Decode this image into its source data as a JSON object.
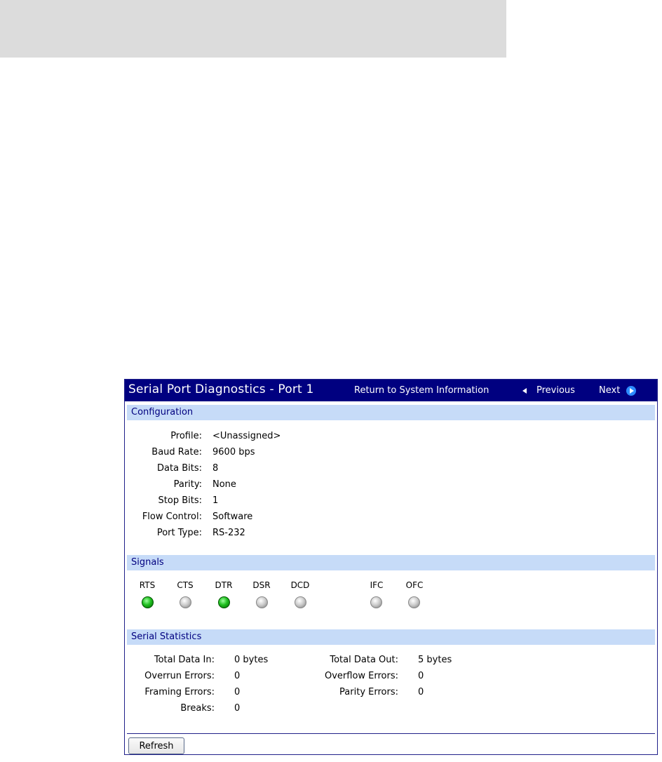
{
  "panel": {
    "title": "Serial Port Diagnostics - Port 1",
    "nav": {
      "return_label": "Return to System Information",
      "previous_label": "Previous",
      "next_label": "Next"
    }
  },
  "configuration": {
    "heading": "Configuration",
    "rows": [
      {
        "label": "Profile:",
        "value": "<Unassigned>"
      },
      {
        "label": "Baud Rate:",
        "value": "9600 bps"
      },
      {
        "label": "Data Bits:",
        "value": "8"
      },
      {
        "label": "Parity:",
        "value": "None"
      },
      {
        "label": "Stop Bits:",
        "value": "1"
      },
      {
        "label": "Flow Control:",
        "value": "Software"
      },
      {
        "label": "Port Type:",
        "value": "RS-232"
      }
    ]
  },
  "signals": {
    "heading": "Signals",
    "items": [
      {
        "name": "RTS",
        "state": "on"
      },
      {
        "name": "CTS",
        "state": "off"
      },
      {
        "name": "DTR",
        "state": "on"
      },
      {
        "name": "DSR",
        "state": "off"
      },
      {
        "name": "DCD",
        "state": "off"
      },
      {
        "name": "IFC",
        "state": "off"
      },
      {
        "name": "OFC",
        "state": "off"
      }
    ]
  },
  "statistics": {
    "heading": "Serial Statistics",
    "left": [
      {
        "label": "Total Data In:",
        "value": "0 bytes"
      },
      {
        "label": "Overrun Errors:",
        "value": "0"
      },
      {
        "label": "Framing Errors:",
        "value": "0"
      },
      {
        "label": "Breaks:",
        "value": "0"
      }
    ],
    "right": [
      {
        "label": "Total Data Out:",
        "value": "5 bytes"
      },
      {
        "label": "Overflow Errors:",
        "value": "0"
      },
      {
        "label": "Parity Errors:",
        "value": "0"
      }
    ]
  },
  "buttons": {
    "refresh_label": "Refresh"
  },
  "colors": {
    "title_bar": "#000080",
    "section_header": "#c6dbf8",
    "led_on": "#20c020",
    "led_off": "#c8c8c8"
  }
}
